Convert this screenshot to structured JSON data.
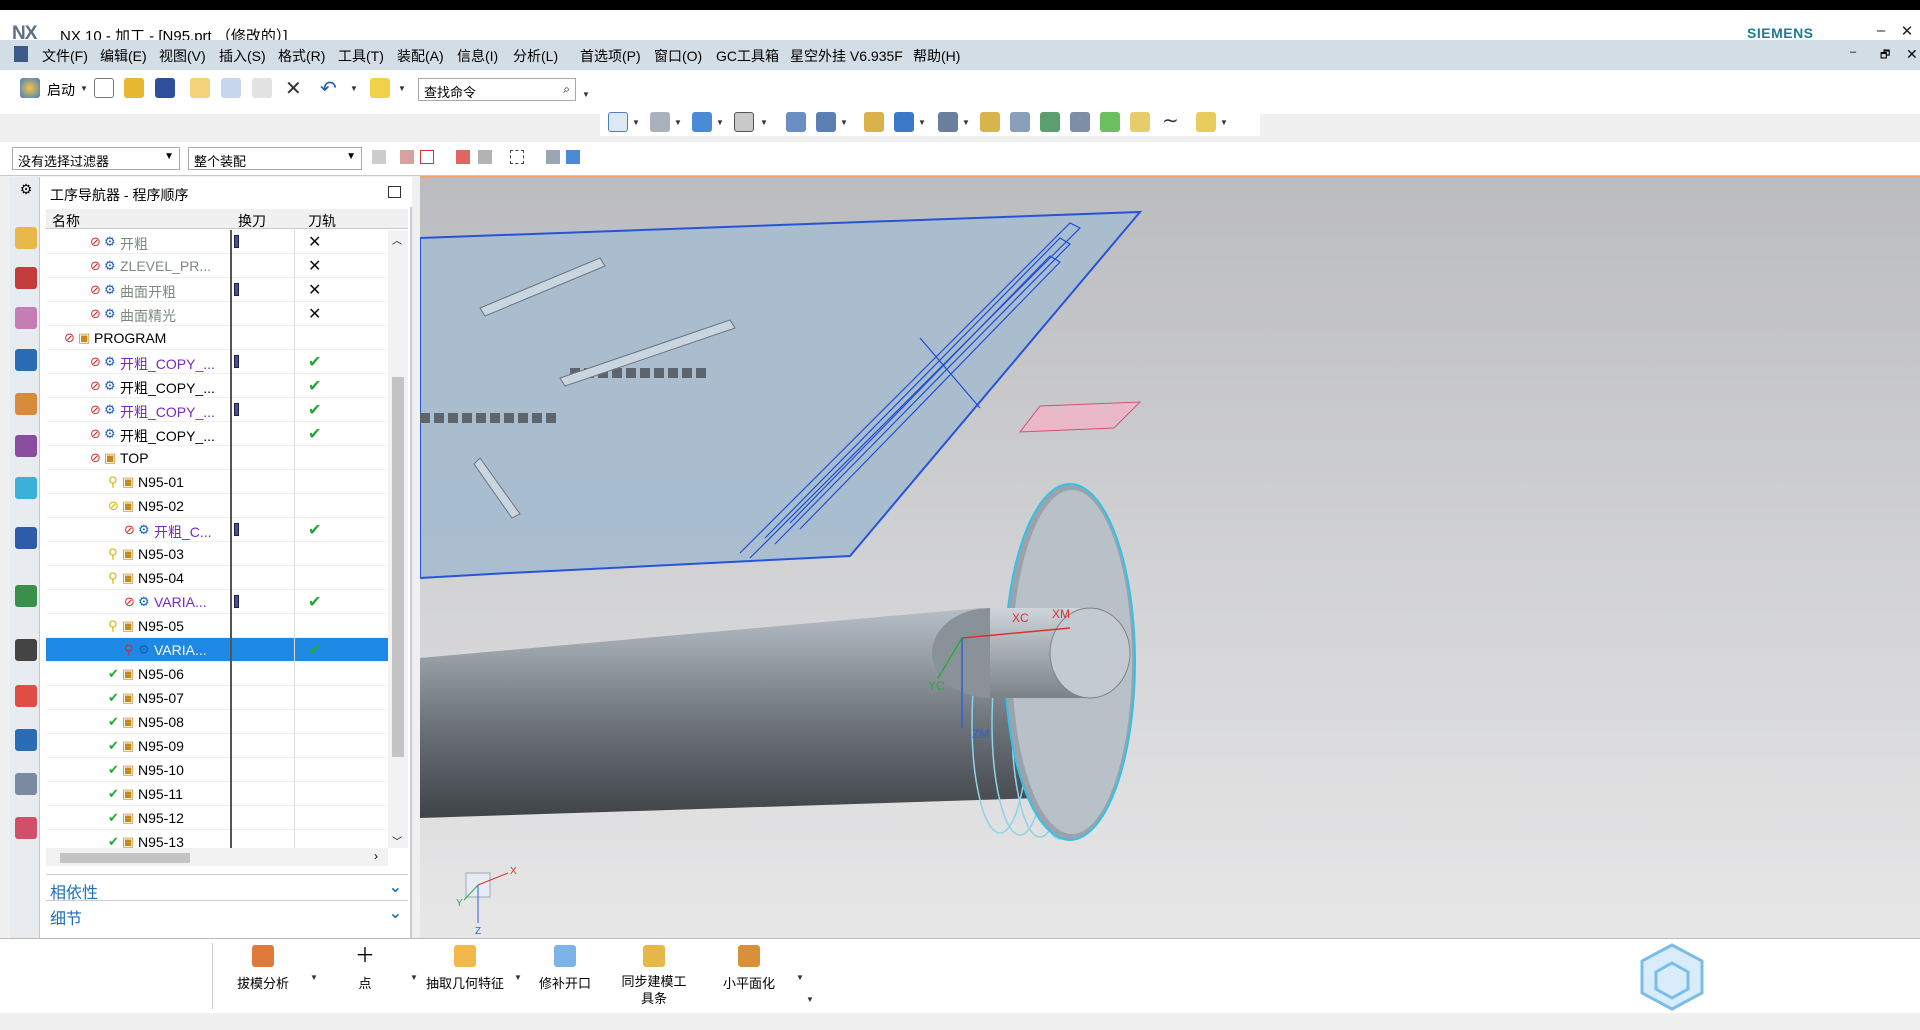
{
  "title_bar": {
    "logo": "NX",
    "title": "NX 10 - 加工 - [N95.prt （修改的）]",
    "brand": "SIEMENS",
    "min": "–",
    "max": "🗗",
    "close": "✕"
  },
  "menu": [
    "文件(F)",
    "编辑(E)",
    "视图(V)",
    "插入(S)",
    "格式(R)",
    "工具(T)",
    "装配(A)",
    "信息(I)",
    "分析(L)",
    "首选项(P)",
    "窗口(O)",
    "GC工具箱",
    "星空外挂 V6.935F",
    "帮助(H)"
  ],
  "toolbar": {
    "start_label": "启动",
    "search_placeholder": "查找命令",
    "filter_value": "没有选择过滤器",
    "assembly_value": "整个装配"
  },
  "navigator": {
    "title": "工序导航器 - 程序顺序",
    "columns": [
      "名称",
      "换刀",
      "刀轨"
    ],
    "rows": [
      {
        "name": "开粗",
        "style": "grey",
        "tool": true,
        "path": "x"
      },
      {
        "name": "ZLEVEL_PR...",
        "style": "grey",
        "tool": false,
        "path": "x"
      },
      {
        "name": "曲面开粗",
        "style": "grey",
        "tool": true,
        "path": "x"
      },
      {
        "name": "曲面精光",
        "style": "grey",
        "tool": false,
        "path": "x"
      },
      {
        "name": "PROGRAM",
        "style": "normal",
        "tool": false,
        "path": ""
      },
      {
        "name": "开粗_COPY_...",
        "style": "purple",
        "tool": true,
        "path": "ok"
      },
      {
        "name": "开粗_COPY_...",
        "style": "normal",
        "tool": false,
        "path": "ok"
      },
      {
        "name": "开粗_COPY_...",
        "style": "purple",
        "tool": true,
        "path": "ok"
      },
      {
        "name": "开粗_COPY_...",
        "style": "normal",
        "tool": false,
        "path": "ok"
      },
      {
        "name": "TOP",
        "style": "normal",
        "tool": false,
        "path": ""
      },
      {
        "name": "N95-01",
        "style": "normal",
        "tool": false,
        "path": ""
      },
      {
        "name": "N95-02",
        "style": "normal",
        "tool": false,
        "path": ""
      },
      {
        "name": "开粗_C...",
        "style": "purple",
        "tool": true,
        "path": "ok"
      },
      {
        "name": "N95-03",
        "style": "normal",
        "tool": false,
        "path": ""
      },
      {
        "name": "N95-04",
        "style": "normal",
        "tool": false,
        "path": ""
      },
      {
        "name": "VARIA...",
        "style": "purple",
        "tool": true,
        "path": "ok"
      },
      {
        "name": "N95-05",
        "style": "normal",
        "tool": false,
        "path": ""
      },
      {
        "name": "VARIA...",
        "style": "selected",
        "tool": false,
        "path": "ok"
      },
      {
        "name": "N95-06",
        "style": "normal",
        "tool": false,
        "path": ""
      },
      {
        "name": "N95-07",
        "style": "normal",
        "tool": false,
        "path": ""
      },
      {
        "name": "N95-08",
        "style": "normal",
        "tool": false,
        "path": ""
      },
      {
        "name": "N95-09",
        "style": "normal",
        "tool": false,
        "path": ""
      },
      {
        "name": "N95-10",
        "style": "normal",
        "tool": false,
        "path": ""
      },
      {
        "name": "N95-11",
        "style": "normal",
        "tool": false,
        "path": ""
      },
      {
        "name": "N95-12",
        "style": "normal",
        "tool": false,
        "path": ""
      },
      {
        "name": "N95-13",
        "style": "normal",
        "tool": false,
        "path": ""
      }
    ],
    "panels": [
      "相依性",
      "细节"
    ]
  },
  "viewport": {
    "axes": [
      "XC",
      "XM",
      "YC",
      "ZM",
      "X",
      "Y",
      "Z"
    ]
  },
  "bottom_tools": [
    "拔模分析",
    "点",
    "抽取几何特征",
    "修补开口",
    "同步建模工具条",
    "小平面化"
  ],
  "colors": {
    "menubar": "#d3dde6",
    "accent": "#1e88e5",
    "siemens": "#1b7c96",
    "check": "#22a832",
    "purple": "#7a28c9"
  }
}
